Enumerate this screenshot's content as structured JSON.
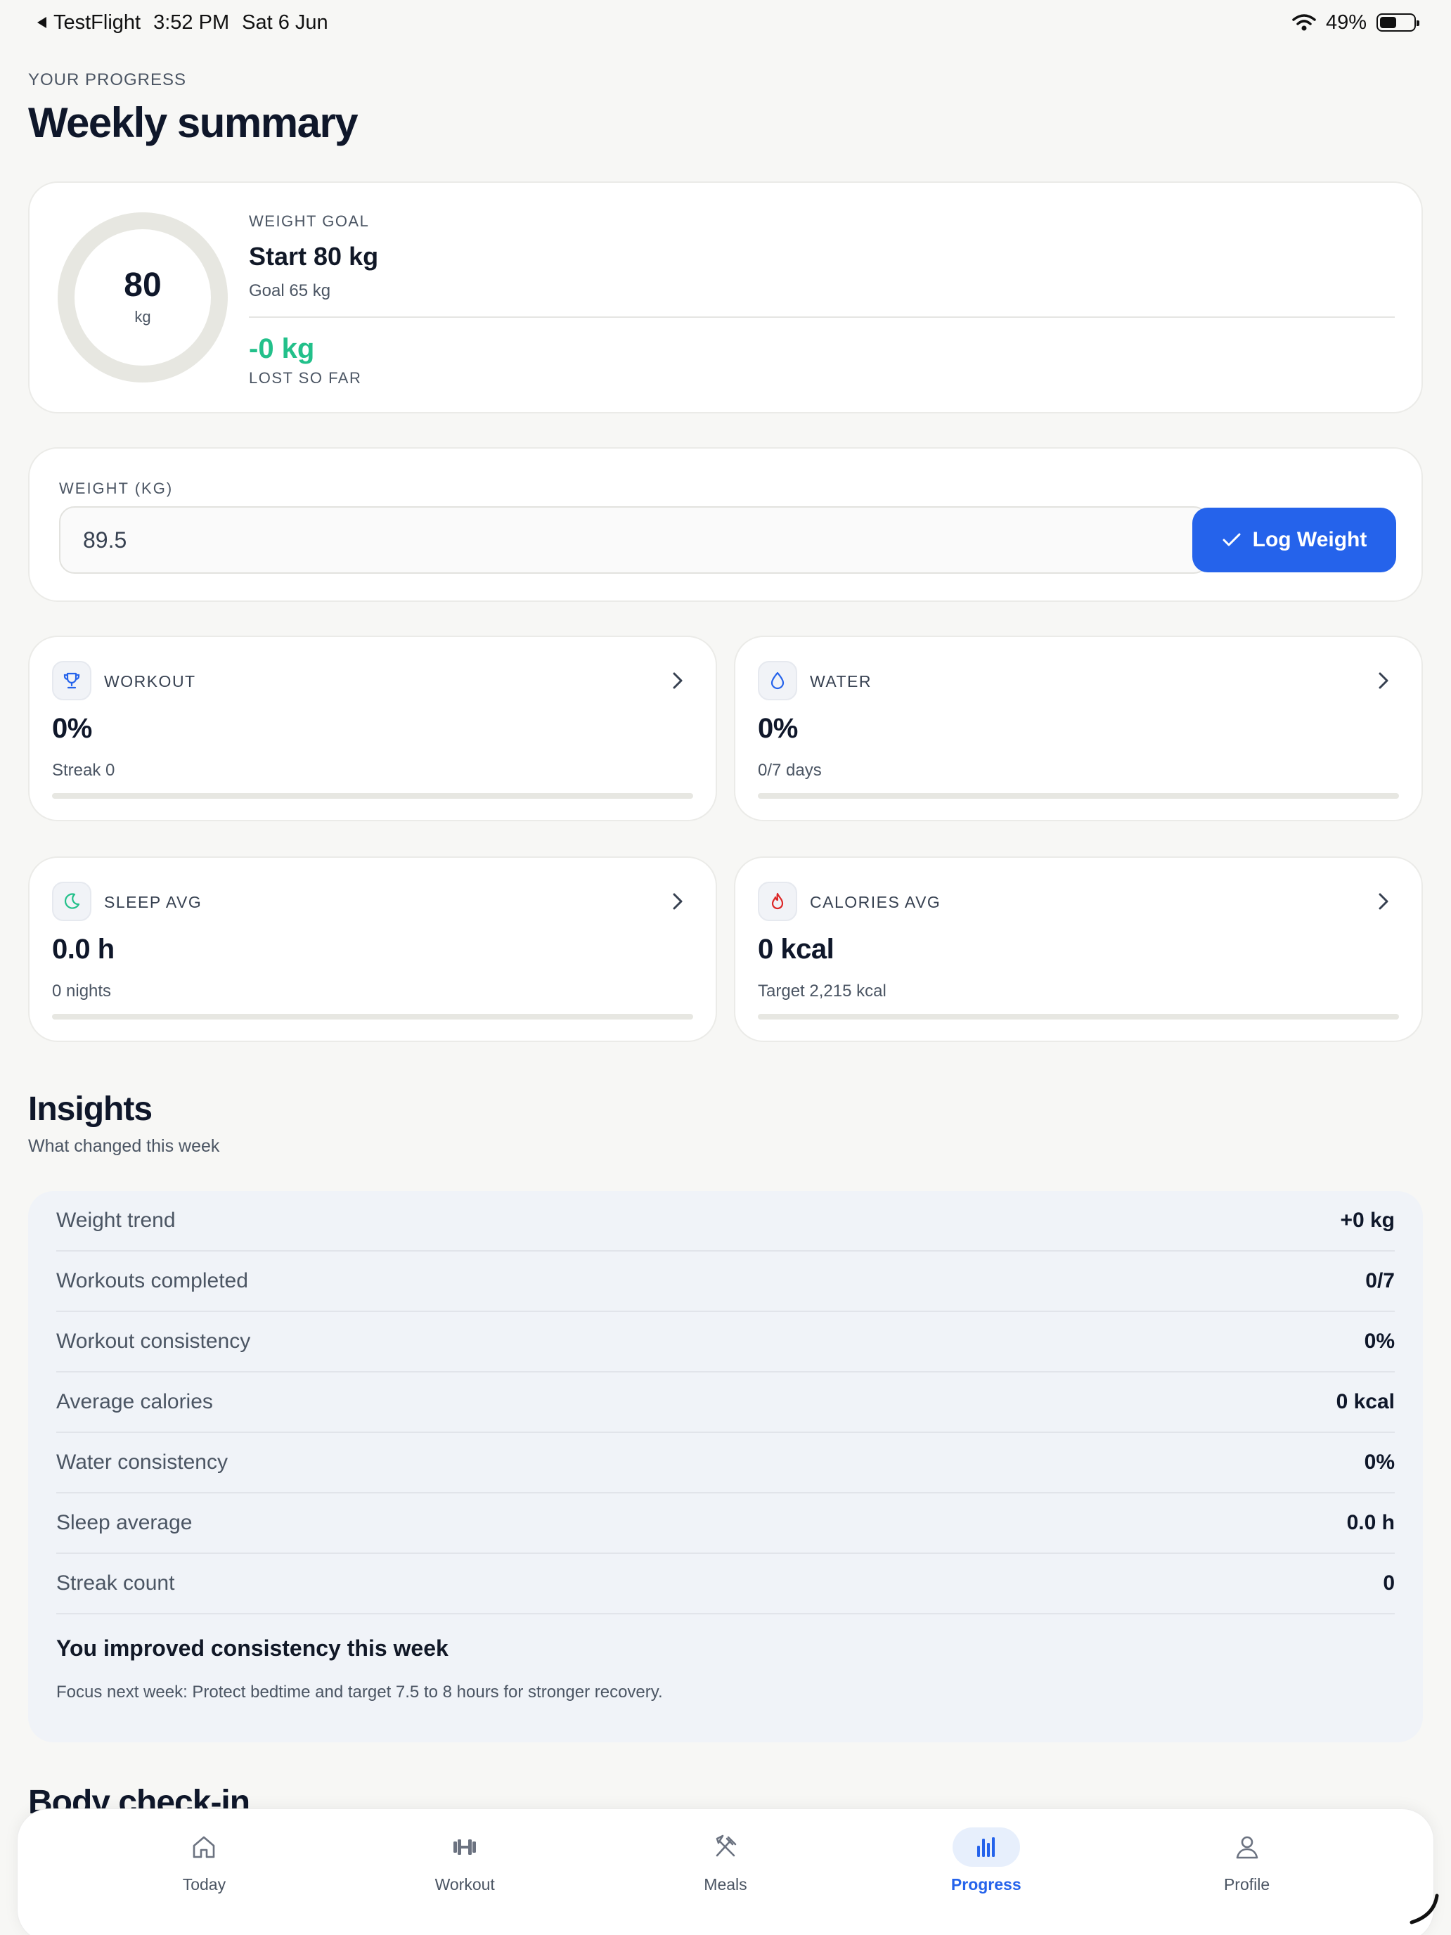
{
  "status_bar": {
    "back_app": "TestFlight",
    "time": "3:52 PM",
    "date": "Sat 6 Jun",
    "battery": "49%",
    "battery_level": 0.49
  },
  "header": {
    "eyebrow": "YOUR PROGRESS",
    "title": "Weekly summary"
  },
  "weight_goal": {
    "ring_value": "80",
    "ring_unit": "kg",
    "label": "WEIGHT GOAL",
    "start": "Start 80 kg",
    "goal": "Goal 65 kg",
    "lost": "-0 kg",
    "lost_label": "LOST SO FAR"
  },
  "weight_entry": {
    "label": "WEIGHT (KG)",
    "value": "89.5",
    "button_label": "Log Weight"
  },
  "stats": {
    "workout": {
      "title": "WORKOUT",
      "value": "0%",
      "sub": "Streak 0",
      "progress": 0,
      "icon": "trophy-icon",
      "icon_color": "#2563eb"
    },
    "water": {
      "title": "WATER",
      "value": "0%",
      "sub": "0/7 days",
      "progress": 0,
      "icon": "droplet-icon",
      "icon_color": "#2563eb"
    },
    "sleep": {
      "title": "SLEEP AVG",
      "value": "0.0 h",
      "sub": "0 nights",
      "progress": 0,
      "icon": "moon-icon",
      "icon_color": "#22c08a"
    },
    "calories": {
      "title": "CALORIES AVG",
      "value": "0 kcal",
      "sub": "Target 2,215 kcal",
      "progress": 0,
      "icon": "flame-icon",
      "icon_color": "#dc2626"
    }
  },
  "insights": {
    "title": "Insights",
    "subtitle": "What changed this week",
    "rows": [
      {
        "label": "Weight trend",
        "value": "+0 kg"
      },
      {
        "label": "Workouts completed",
        "value": "0/7"
      },
      {
        "label": "Workout consistency",
        "value": "0%"
      },
      {
        "label": "Average calories",
        "value": "0 kcal"
      },
      {
        "label": "Water consistency",
        "value": "0%"
      },
      {
        "label": "Sleep average",
        "value": "0.0 h"
      },
      {
        "label": "Streak count",
        "value": "0"
      }
    ],
    "headline": "You improved consistency this week",
    "focus": "Focus next week: Protect bedtime and target 7.5 to 8 hours for stronger recovery."
  },
  "next_section_title": "Body check-in",
  "tabs": [
    {
      "label": "Today",
      "icon": "house-icon",
      "active": false
    },
    {
      "label": "Workout",
      "icon": "dumbbell-icon",
      "active": false
    },
    {
      "label": "Meals",
      "icon": "fork-knife-icon",
      "active": false
    },
    {
      "label": "Progress",
      "icon": "bar-chart-icon",
      "active": true
    },
    {
      "label": "Profile",
      "icon": "person-icon",
      "active": false
    }
  ],
  "colors": {
    "accent": "#2563eb",
    "success": "#22c08a",
    "danger": "#dc2626"
  }
}
